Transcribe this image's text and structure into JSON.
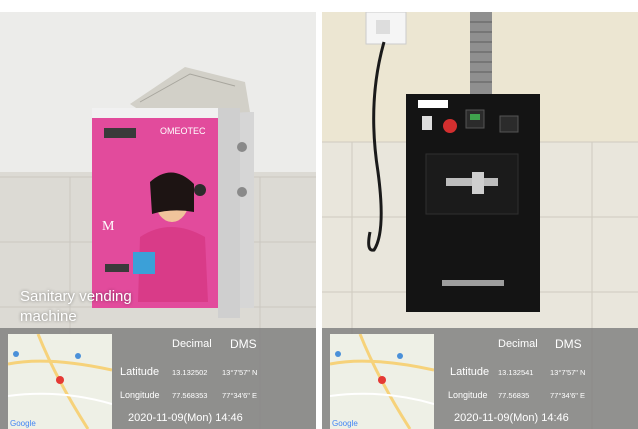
{
  "left_photo": {
    "caption_line1": "Sanitary vending",
    "caption_line2": "machine",
    "brand": "OMEOTEC",
    "box_color": "#e24b9c",
    "geo": {
      "header_decimal": "Decimal",
      "header_dms": "DMS",
      "latitude_label": "Latitude",
      "latitude_decimal": "13.132502",
      "latitude_dms": "13°7'57\" N",
      "longitude_label": "Longitude",
      "longitude_decimal": "77.568353",
      "longitude_dms": "77°34'6\" E",
      "datetime": "2020-11-09(Mon)  14:46"
    }
  },
  "right_photo": {
    "machine_color": "#141414",
    "geo": {
      "header_decimal": "Decimal",
      "header_dms": "DMS",
      "latitude_label": "Latitude",
      "latitude_decimal": "13.132541",
      "latitude_dms": "13°7'57\" N",
      "longitude_label": "Longitude",
      "longitude_decimal": "77.56835",
      "longitude_dms": "77°34'6\" E",
      "datetime": "2020-11-09(Mon)  14:46"
    }
  }
}
